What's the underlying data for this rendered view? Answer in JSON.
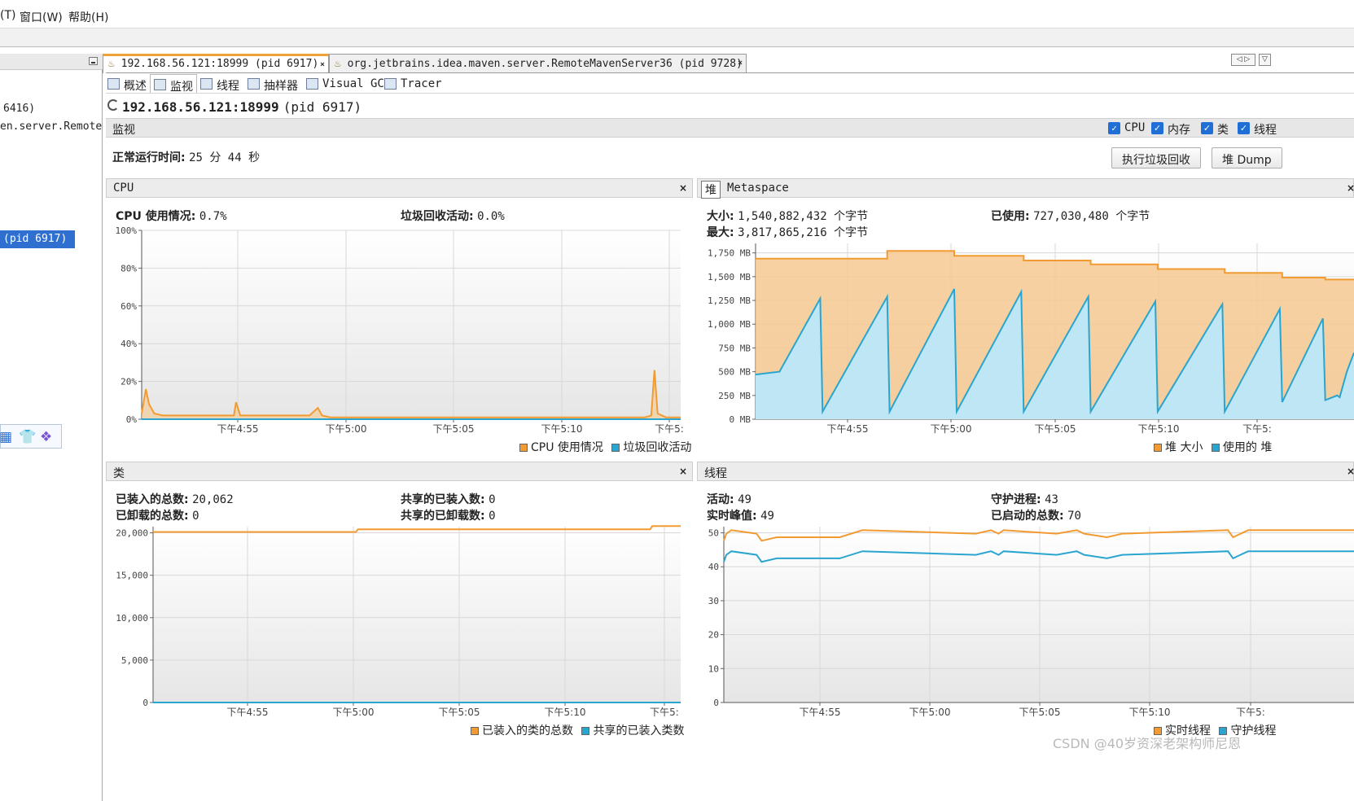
{
  "colors": {
    "orange": "#f29b32",
    "blue": "#2aa5cf",
    "orange_fill": "#f6c990",
    "blue_fill": "#bfe6f5"
  },
  "menubar": {
    "items": [
      "(T)",
      "窗口(W)",
      "帮助(H)"
    ]
  },
  "sidebar": {
    "items": [
      "6416)",
      "en.server.Remote",
      "(pid 6917)"
    ],
    "icons": [
      "grid-icon",
      "shirt-icon",
      "apps-icon"
    ]
  },
  "tabs": [
    {
      "label": "192.168.56.121:18999 (pid 6917)",
      "close": "×"
    },
    {
      "label": "org.jetbrains.idea.maven.server.RemoteMavenServer36 (pid 9728)",
      "close": "×"
    }
  ],
  "nav": [
    "◁ ▷",
    "▽"
  ],
  "subtabs": [
    "概述",
    "监视",
    "线程",
    "抽样器",
    "Visual GC",
    "Tracer"
  ],
  "app": {
    "title": "192.168.56.121:18999",
    "pid": "(pid 6917)"
  },
  "monitor": {
    "label": "监视",
    "checkboxes": [
      "CPU",
      "内存",
      "类",
      "线程"
    ],
    "uptime_label": "正常运行时间:",
    "uptime_value": "25 分 44 秒",
    "gc_button": "执行垃圾回收",
    "dump_button": "堆 Dump"
  },
  "cpu_panel": {
    "title": "CPU",
    "close": "×",
    "usage_label": "CPU 使用情况:",
    "usage_value": "0.7%",
    "gc_label": "垃圾回收活动:",
    "gc_value": "0.0%",
    "legend": [
      "CPU 使用情况",
      "垃圾回收活动"
    ]
  },
  "heap_panel": {
    "tab_heap": "堆",
    "tab_meta": "Metaspace",
    "close": "×",
    "size_label": "大小:",
    "size_value": "1,540,882,432 个字节",
    "used_label": "已使用:",
    "used_value": "727,030,480 个字节",
    "max_label": "最大:",
    "max_value": "3,817,865,216 个字节",
    "legend": [
      "堆 大小",
      "使用的 堆"
    ]
  },
  "classes_panel": {
    "title": "类",
    "close": "×",
    "loaded_label": "已装入的总数:",
    "loaded_value": "20,062",
    "unloaded_label": "已卸载的总数:",
    "unloaded_value": "0",
    "shared_loaded_label": "共享的已装入数:",
    "shared_loaded_value": "0",
    "shared_unloaded_label": "共享的已卸载数:",
    "shared_unloaded_value": "0",
    "legend": [
      "已装入的类的总数",
      "共享的已装入类数"
    ]
  },
  "threads_panel": {
    "title": "线程",
    "close": "×",
    "live_label": "活动:",
    "live_value": "49",
    "peak_label": "实时峰值:",
    "peak_value": "49",
    "daemon_label": "守护进程:",
    "daemon_value": "43",
    "started_label": "已启动的总数:",
    "started_value": "70",
    "legend": [
      "实时线程",
      "守护线程"
    ]
  },
  "watermark": "CSDN @40岁资深老架构师尼恩",
  "chart_data": [
    {
      "type": "area",
      "title": "CPU",
      "time_ticks": [
        "下午4:55",
        "下午5:00",
        "下午5:05",
        "下午5:10",
        "下午5:"
      ],
      "y_ticks": [
        "100%",
        "80%",
        "60%",
        "40%",
        "20%",
        "0%"
      ],
      "ylim": [
        0,
        100
      ],
      "x_minutes": [
        0,
        0.2,
        0.35,
        0.6,
        1,
        2,
        3.5,
        4.4,
        4.5,
        4.7,
        6,
        8,
        8.4,
        8.6,
        9,
        12,
        15,
        18,
        20,
        22,
        24,
        24.3,
        24.45,
        24.6,
        25,
        25.7
      ],
      "series": [
        {
          "name": "CPU 使用情况",
          "values": [
            3,
            16,
            8,
            3,
            2,
            2,
            2,
            2,
            9,
            2,
            2,
            2,
            6,
            2,
            1,
            1,
            1,
            1,
            1,
            1,
            1,
            2,
            26,
            3,
            1,
            1
          ]
        },
        {
          "name": "垃圾回收活动",
          "values": [
            0,
            0,
            0,
            0,
            0,
            0,
            0,
            0,
            0,
            0,
            0,
            0,
            0,
            0,
            0,
            0,
            0,
            0,
            0,
            0,
            0,
            0,
            0,
            0,
            0,
            0
          ]
        }
      ]
    },
    {
      "type": "area",
      "title": "堆",
      "time_ticks": [
        "下午4:55",
        "下午5:00",
        "下午5:05",
        "下午5:10",
        "下午5:"
      ],
      "y_ticks": [
        "1,750 MB",
        "1,500 MB",
        "1,250 MB",
        "1,000 MB",
        "750 MB",
        "500 MB",
        "250 MB",
        "0 MB"
      ],
      "ylim": [
        0,
        1850
      ],
      "size_series": {
        "name": "堆 大小",
        "x_minutes": [
          0,
          5.5,
          5.5,
          8.3,
          8.3,
          11.2,
          11.2,
          14.0,
          14.0,
          16.8,
          16.8,
          19.6,
          19.6,
          22.0,
          22.0,
          23.8,
          23.8,
          25.0
        ],
        "values": [
          1690,
          1690,
          1770,
          1770,
          1720,
          1720,
          1670,
          1670,
          1630,
          1630,
          1580,
          1580,
          1540,
          1540,
          1490,
          1490,
          1470,
          1470
        ]
      },
      "used_series": {
        "name": "使用的 堆",
        "x_minutes": [
          0,
          1,
          2.7,
          2.8,
          5.5,
          5.6,
          8.3,
          8.4,
          11.1,
          11.2,
          13.9,
          14.0,
          16.7,
          16.8,
          19.5,
          19.6,
          21.9,
          22.0,
          23.7,
          23.8,
          24.3,
          24.4,
          24.7,
          25.0
        ],
        "values": [
          470,
          500,
          1270,
          80,
          1290,
          80,
          1370,
          80,
          1340,
          80,
          1290,
          80,
          1240,
          80,
          1210,
          80,
          1160,
          180,
          1060,
          200,
          250,
          230,
          500,
          700
        ]
      }
    },
    {
      "type": "line",
      "title": "类",
      "time_ticks": [
        "下午4:55",
        "下午5:00",
        "下午5:05",
        "下午5:10",
        "下午5:"
      ],
      "y_ticks": [
        "20,000",
        "15,000",
        "10,000",
        "5,000",
        "0"
      ],
      "ylim": [
        0,
        20000
      ],
      "x_minutes": [
        0,
        10,
        10.1,
        24.5,
        24.6,
        26
      ],
      "series": [
        {
          "name": "已装入的类的总数",
          "values": [
            19400,
            19400,
            19700,
            19700,
            20062,
            20062
          ]
        },
        {
          "name": "共享的已装入类数",
          "values": [
            0,
            0,
            0,
            0,
            0,
            0
          ]
        }
      ]
    },
    {
      "type": "line",
      "title": "线程",
      "time_ticks": [
        "下午4:55",
        "下午5:00",
        "下午5:05",
        "下午5:10",
        "下午5:"
      ],
      "y_ticks": [
        "50",
        "40",
        "30",
        "20",
        "10",
        "0"
      ],
      "ylim": [
        0,
        50
      ],
      "x_minutes": [
        0,
        0.1,
        0.3,
        1.3,
        1.5,
        2.1,
        4.6,
        5.5,
        10.0,
        10.6,
        10.9,
        11.1,
        13.2,
        14.0,
        14.3,
        15.2,
        15.8,
        20.0,
        20.2,
        20.8,
        25.0
      ],
      "series": [
        {
          "name": "实时线程",
          "values": [
            46,
            48,
            49,
            48,
            46,
            47,
            47,
            49,
            48,
            49,
            48,
            49,
            48,
            49,
            48,
            47,
            48,
            49,
            47,
            49,
            49
          ]
        },
        {
          "name": "守护线程",
          "values": [
            40,
            42,
            43,
            42,
            40,
            41,
            41,
            43,
            42,
            43,
            42,
            43,
            42,
            43,
            42,
            41,
            42,
            43,
            41,
            43,
            43
          ]
        }
      ]
    }
  ]
}
